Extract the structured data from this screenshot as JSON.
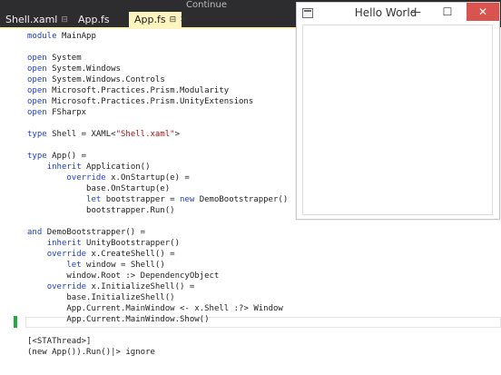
{
  "ide": {
    "menu_hint": "Continue",
    "tabs": [
      {
        "label": "Shell.xaml",
        "icon": "pin-icon",
        "active": false
      },
      {
        "label": "App.fs",
        "active": false
      },
      {
        "label": "App.fs",
        "icon": "pin-icon",
        "close": "close-icon",
        "active": true
      }
    ],
    "code_lines": [
      "module MainApp",
      "",
      "open System",
      "open System.Windows",
      "open System.Windows.Controls",
      "open Microsoft.Practices.Prism.Modularity",
      "open Microsoft.Practices.Prism.UnityExtensions",
      "open FSharpx",
      "",
      "type Shell = XAML<\"Shell.xaml\">",
      "",
      "type App() =",
      "    inherit Application()",
      "        override x.OnStartup(e) =",
      "            base.OnStartup(e)",
      "            let bootstrapper = new DemoBootstrapper()",
      "            bootstrapper.Run()",
      "",
      "and DemoBootstrapper() =",
      "    inherit UnityBootstrapper()",
      "    override x.CreateShell() =",
      "        let window = Shell()",
      "        window.Root :> DependencyObject",
      "    override x.InitializeShell() =",
      "        base.InitializeShell()",
      "        App.Current.MainWindow <- x.Shell :?> Window",
      "        App.Current.MainWindow.Show()",
      "",
      "[<STAThread>]",
      "(new App()).Run()|> ignore"
    ]
  },
  "window": {
    "title": "Hello World",
    "app_icon": "window-app-icon",
    "minimize": "—",
    "maximize": "☐",
    "close": "✕"
  },
  "colors": {
    "tab_bar": "#2d2d30",
    "active_tab": "#fdf4bf",
    "keyword": "#1f3fcf",
    "string": "#a31515",
    "change_bar": "#27a844",
    "close_button": "#d9534f"
  }
}
